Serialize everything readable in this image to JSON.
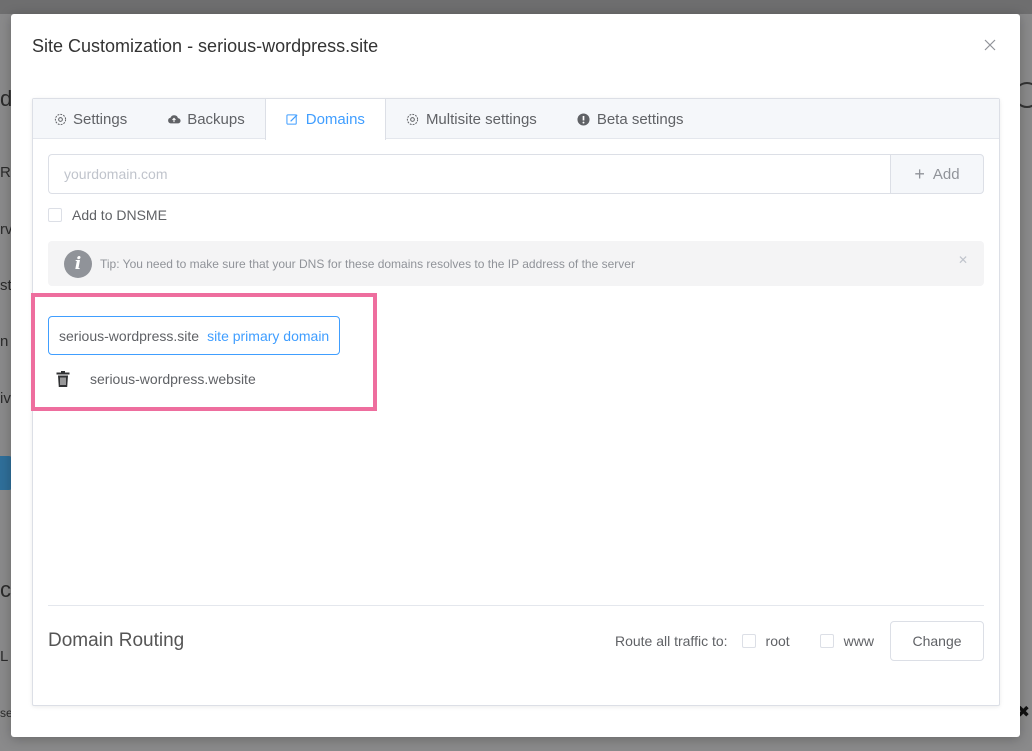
{
  "background": {
    "fragments": [
      "d",
      "RL",
      "rv",
      "st",
      "n",
      "iv",
      "ct",
      "L",
      "se"
    ]
  },
  "modal": {
    "title": "Site Customization - serious-wordpress.site",
    "close_icon": "close-icon"
  },
  "tabs": [
    {
      "label": "Settings",
      "icon": "gear-icon",
      "active": false
    },
    {
      "label": "Backups",
      "icon": "cloud-upload-icon",
      "active": false
    },
    {
      "label": "Domains",
      "icon": "edit-icon",
      "active": true
    },
    {
      "label": "Multisite settings",
      "icon": "gear-icon",
      "active": false
    },
    {
      "label": "Beta settings",
      "icon": "exclamation-circle-icon",
      "active": false
    }
  ],
  "domains": {
    "input_placeholder": "yourdomain.com",
    "add_label": "Add",
    "dnsme_label": "Add to DNSME",
    "tip_text": "Tip: You need to make sure that your DNS for these domains resolves to the IP address of the server",
    "primary": {
      "name": "serious-wordpress.site",
      "tag": "site primary domain"
    },
    "secondary": [
      {
        "name": "serious-wordpress.website"
      }
    ]
  },
  "routing": {
    "title": "Domain Routing",
    "label": "Route all traffic to:",
    "options": [
      {
        "label": "root"
      },
      {
        "label": "www"
      }
    ],
    "change_label": "Change"
  },
  "colors": {
    "accent": "#409eff",
    "highlight_box": "#ee6e9e"
  }
}
